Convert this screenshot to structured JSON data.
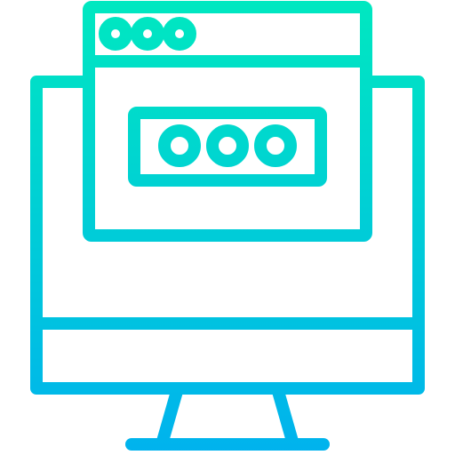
{
  "icon": {
    "name": "computer-password-window-icon",
    "colors": {
      "gradient_top": "#00e8c0",
      "gradient_bottom": "#00b2ee",
      "background": "#ffffff"
    }
  }
}
